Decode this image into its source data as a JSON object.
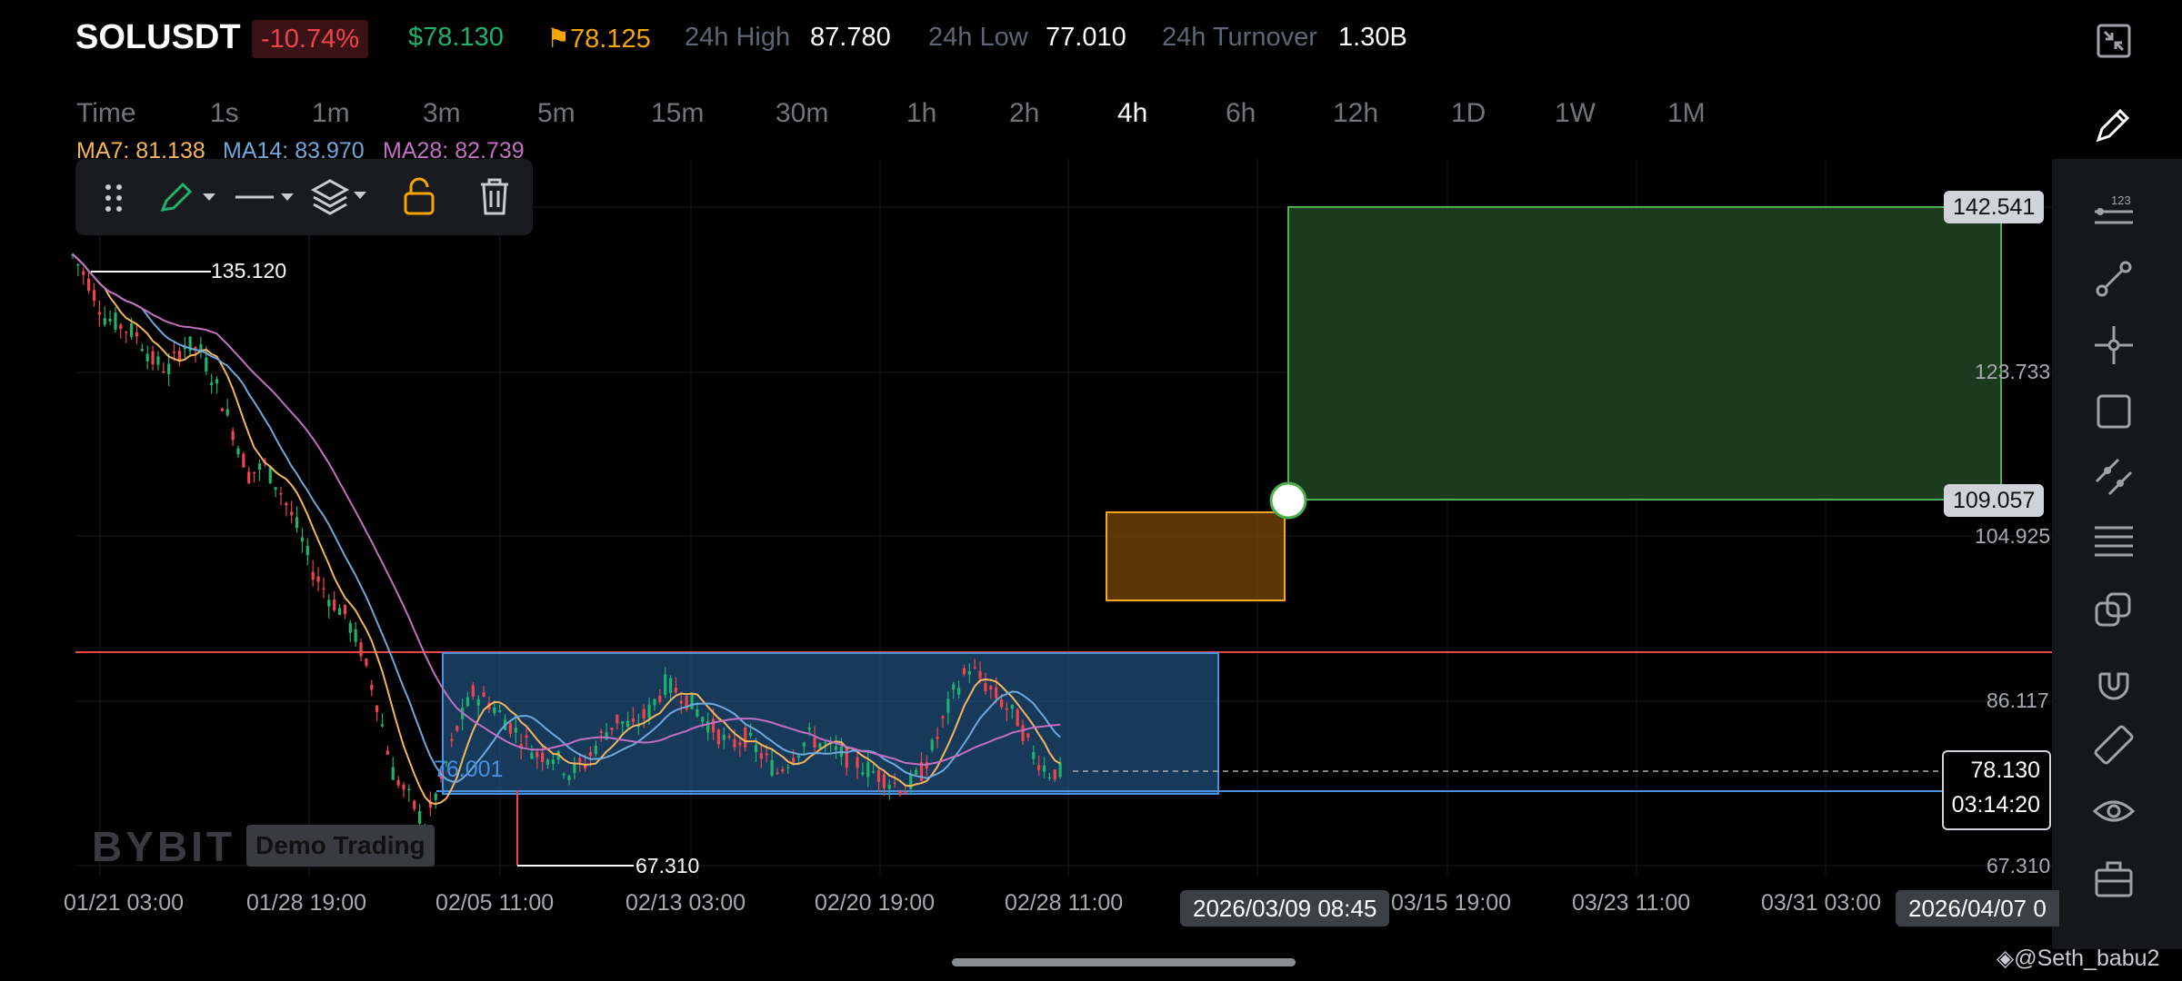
{
  "header": {
    "symbol": "SOLUSDT",
    "change_pct": "-10.74%",
    "last_price": "$78.130",
    "mark_price": "78.125",
    "high_label": "24h High",
    "high_value": "87.780",
    "low_label": "24h Low",
    "low_value": "77.010",
    "turnover_label": "24h Turnover",
    "turnover_value": "1.30B"
  },
  "timeframes": [
    "Time",
    "1s",
    "1m",
    "3m",
    "5m",
    "15m",
    "30m",
    "1h",
    "2h",
    "4h",
    "6h",
    "12h",
    "1D",
    "1W",
    "1M"
  ],
  "active_timeframe": "4h",
  "ma": {
    "ma7": "MA7: 81.138",
    "ma14": "MA14: 83.970",
    "ma28": "MA28: 82.739"
  },
  "annotations": {
    "high_marker": "135.120",
    "low_marker": "67.310",
    "range_label": "76.001"
  },
  "y_axis": {
    "labels": [
      "123.733",
      "104.925",
      "86.117",
      "67.310"
    ],
    "tag_top": "142.541",
    "tag_mid": "109.057",
    "price_tag": "78.130",
    "countdown": "03:14:20"
  },
  "x_axis": {
    "labels": [
      "01/21 03:00",
      "01/28 19:00",
      "02/05 11:00",
      "02/13 03:00",
      "02/20 19:00",
      "02/28 11:00",
      "03/15 19:00",
      "03/23 11:00",
      "03/31 03:00"
    ],
    "tag_left": "2026/03/09 08:45",
    "tag_right": "2026/04/07 0"
  },
  "watermark": {
    "brand": "BYBIT",
    "mode": "Demo Trading"
  },
  "credit": "@Seth_babu2",
  "colors": {
    "up": "#20b26c",
    "down": "#ef454a",
    "ma7": "#f5b65b",
    "ma14": "#6fa8dc",
    "ma28": "#c46fc4",
    "box_blue": "#4a90e2",
    "box_green": "#4caf50",
    "box_orange": "#f5a623"
  },
  "chart_data": {
    "type": "candlestick",
    "interval": "4h",
    "y_range": [
      60,
      150
    ],
    "horizontal_line": 92.5,
    "ranges": {
      "consolidation_box": {
        "top": 92.5,
        "bottom": 76.001
      },
      "target_box": {
        "top": 142.541,
        "bottom": 109.057
      },
      "entry_box": {
        "top": 107.5,
        "bottom": 96.5
      }
    },
    "approx_close_path": [
      137,
      134,
      130,
      129,
      128,
      125,
      124,
      127,
      126,
      122,
      117,
      112,
      113,
      110,
      106,
      101,
      98,
      96,
      92,
      86,
      78,
      75,
      72,
      77,
      83,
      87,
      86,
      84,
      82,
      80,
      80,
      78,
      79,
      82,
      84,
      83,
      85,
      88,
      87,
      85,
      83,
      81,
      82,
      80,
      78,
      80,
      82,
      81,
      80,
      79,
      78,
      77,
      76,
      78,
      82,
      87,
      90,
      88,
      86,
      84,
      80,
      78
    ]
  }
}
